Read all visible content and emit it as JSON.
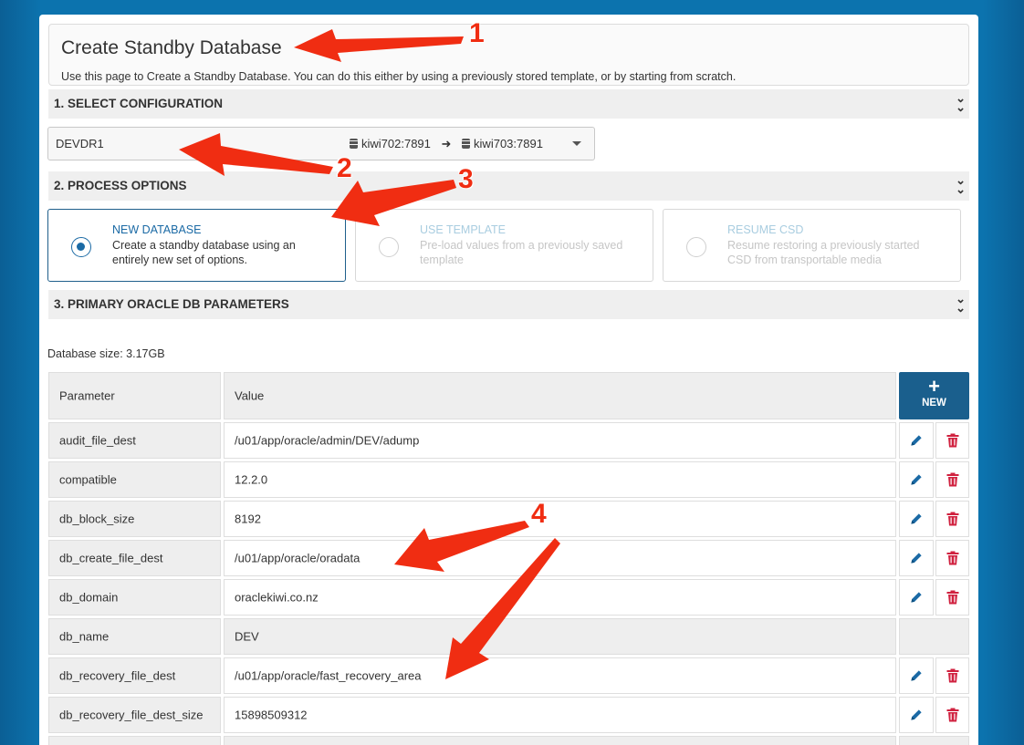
{
  "header": {
    "title": "Create Standby Database",
    "description": "Use this page to Create a Standby Database. You can do this either by using a previously stored template, or by starting from scratch."
  },
  "sections": {
    "configuration": "1. SELECT CONFIGURATION",
    "process": "2. PROCESS OPTIONS",
    "parameters": "3. PRIMARY ORACLE DB PARAMETERS"
  },
  "config_select": {
    "value": "DEVDR1",
    "source": "kiwi702:7891",
    "target": "kiwi703:7891"
  },
  "options": [
    {
      "title": "NEW DATABASE",
      "description": "Create a standby database using an entirely new set of options.",
      "selected": true
    },
    {
      "title": "USE TEMPLATE",
      "description": "Pre-load values from a previously saved template",
      "selected": false
    },
    {
      "title": "RESUME CSD",
      "description": "Resume restoring a previously started CSD from transportable media",
      "selected": false
    }
  ],
  "database_size": "Database size: 3.17GB",
  "table": {
    "headers": {
      "parameter": "Parameter",
      "value": "Value",
      "new_button": "NEW"
    },
    "rows": [
      {
        "parameter": "audit_file_dest",
        "value": "/u01/app/oracle/admin/DEV/adump",
        "editable": true
      },
      {
        "parameter": "compatible",
        "value": "12.2.0",
        "editable": true
      },
      {
        "parameter": "db_block_size",
        "value": "8192",
        "editable": true
      },
      {
        "parameter": "db_create_file_dest",
        "value": "/u01/app/oracle/oradata",
        "editable": true
      },
      {
        "parameter": "db_domain",
        "value": "oraclekiwi.co.nz",
        "editable": true
      },
      {
        "parameter": "db_name",
        "value": "DEV",
        "editable": false
      },
      {
        "parameter": "db_recovery_file_dest",
        "value": "/u01/app/oracle/fast_recovery_area",
        "editable": true
      },
      {
        "parameter": "db_recovery_file_dest_size",
        "value": "15898509312",
        "editable": true
      }
    ]
  },
  "annotations": [
    "1",
    "2",
    "3",
    "4"
  ],
  "colors": {
    "background": "#0c73ae",
    "accent": "#1b6aa5",
    "new_button": "#1a5f8d",
    "delete_icon": "#d0213f",
    "annotation_arrow": "#f02d12"
  }
}
